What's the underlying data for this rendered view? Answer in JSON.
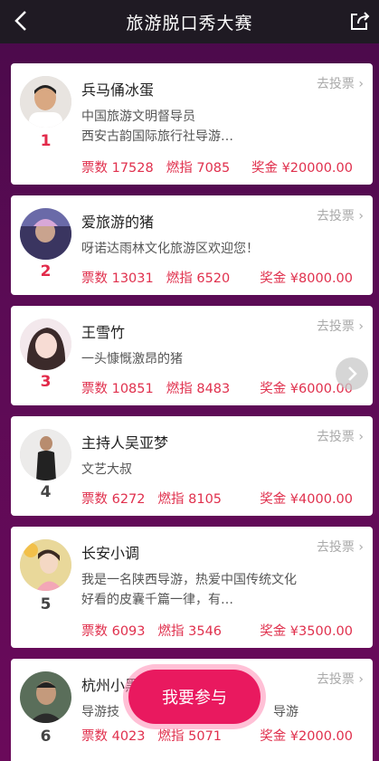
{
  "nav": {
    "title": "旅游脱口秀大赛"
  },
  "vote_label": "去投票",
  "entries": [
    {
      "rank": "1",
      "rank_color": "red",
      "name": "兵马俑冰蛋",
      "desc": [
        "中国旅游文明督导员",
        "西安古韵国际旅行社导游…"
      ],
      "votes": "票数 17528",
      "heat": "燃指 7085",
      "prize": "奖金 ¥20000.00"
    },
    {
      "rank": "2",
      "rank_color": "red",
      "name": "爱旅游的猪",
      "desc": [
        "呀诺达雨林文化旅游区欢迎您！"
      ],
      "votes": "票数 13031",
      "heat": "燃指 6520",
      "prize": "奖金 ¥8000.00"
    },
    {
      "rank": "3",
      "rank_color": "red",
      "name": "王雪竹",
      "desc": [
        "一头慷慨激昂的猪"
      ],
      "votes": "票数 10851",
      "heat": "燃指 8483",
      "prize": "奖金 ¥6000.00"
    },
    {
      "rank": "4",
      "rank_color": "gray",
      "name": "主持人吴亚梦",
      "desc": [
        "文艺大叔"
      ],
      "votes": "票数 6272",
      "heat": "燃指 8105",
      "prize": "奖金 ¥4000.00"
    },
    {
      "rank": "5",
      "rank_color": "gray",
      "name": "长安小调",
      "desc": [
        "我是一名陕西导游，热爱中国传统文化",
        "好看的皮囊千篇一律，有…"
      ],
      "votes": "票数 6093",
      "heat": "燃指 3546",
      "prize": "奖金 ¥3500.00"
    },
    {
      "rank": "6",
      "rank_color": "gray",
      "name": "杭州小黑",
      "desc": [
        "导游技",
        "导游"
      ],
      "votes": "票数 4023",
      "heat": "燃指 5071",
      "prize": "奖金 ¥2000.00"
    }
  ],
  "join_button": "我要参与",
  "colors": {
    "accent": "#e9195f",
    "stat_red": "#e0304d",
    "background": "#5b0b55"
  }
}
